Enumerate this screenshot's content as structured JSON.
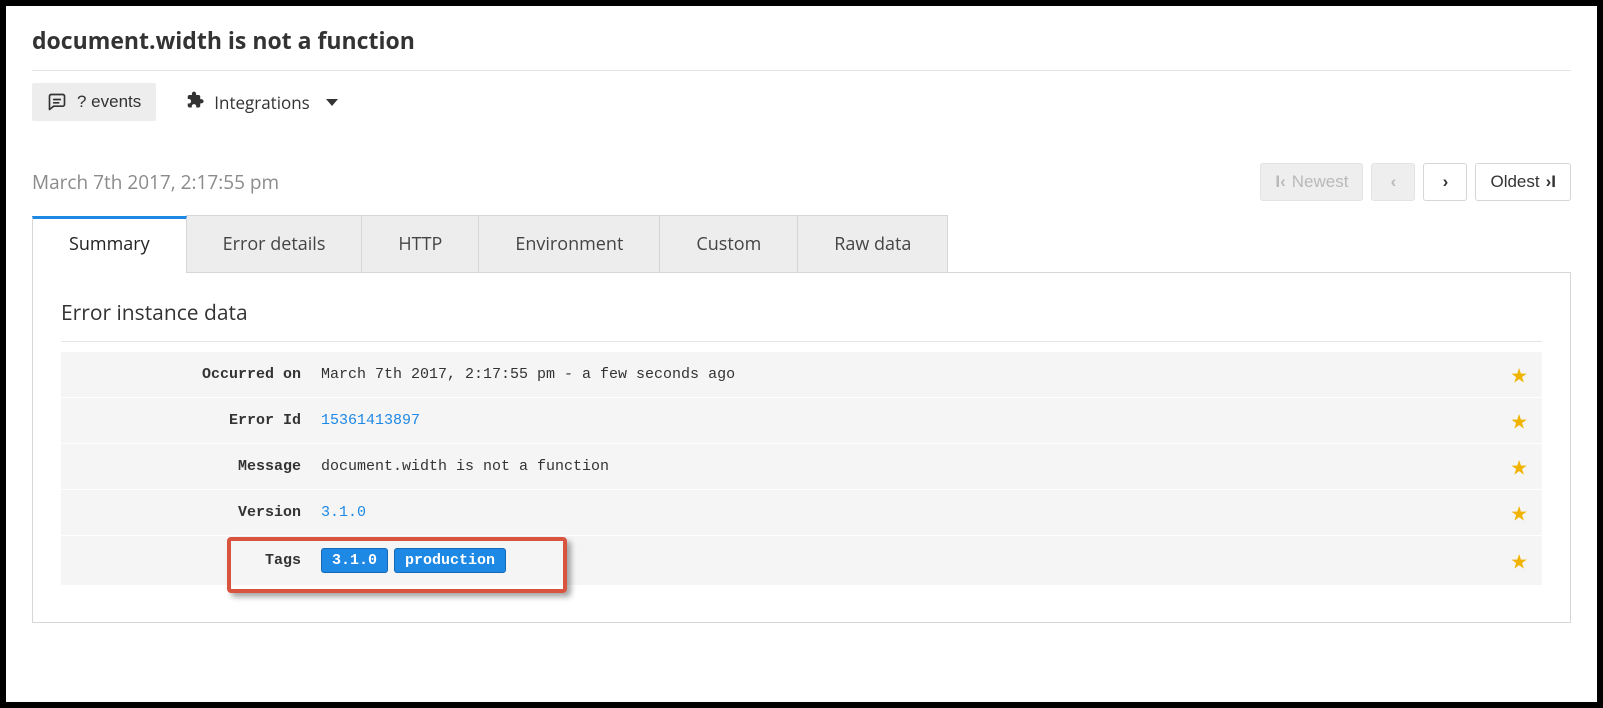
{
  "title": "document.width is not a function",
  "toolbar": {
    "events_label": "? events",
    "integrations_label": "Integrations"
  },
  "timestamp": "March 7th 2017, 2:17:55 pm",
  "pager": {
    "newest": "Newest",
    "oldest": "Oldest"
  },
  "tabs": [
    "Summary",
    "Error details",
    "HTTP",
    "Environment",
    "Custom",
    "Raw data"
  ],
  "panel": {
    "title": "Error instance data",
    "rows": [
      {
        "label": "Occurred on",
        "value": "March 7th 2017, 2:17:55 pm - a few seconds ago",
        "link": false
      },
      {
        "label": "Error Id",
        "value": "15361413897",
        "link": true
      },
      {
        "label": "Message",
        "value": "document.width is not a function",
        "link": false
      },
      {
        "label": "Version",
        "value": "3.1.0",
        "link": true
      }
    ],
    "tags_label": "Tags",
    "tags": [
      "3.1.0",
      "production"
    ]
  }
}
